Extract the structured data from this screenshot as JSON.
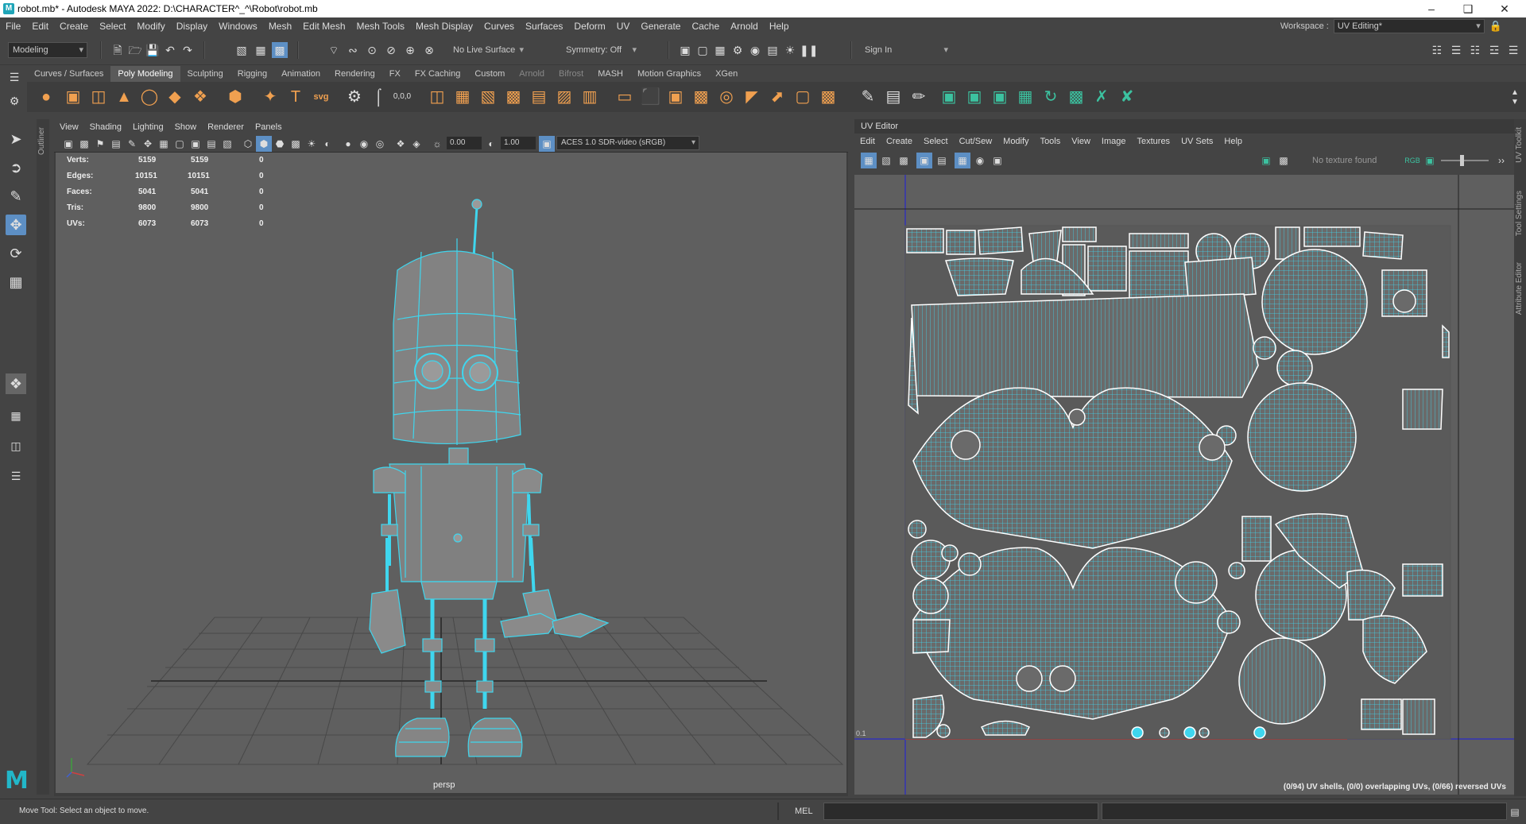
{
  "window": {
    "title": "robot.mb* - Autodesk MAYA 2022: D:\\CHARACTER^_^\\Robot\\robot.mb"
  },
  "menus": [
    "File",
    "Edit",
    "Create",
    "Select",
    "Modify",
    "Display",
    "Windows",
    "Mesh",
    "Edit Mesh",
    "Mesh Tools",
    "Mesh Display",
    "Curves",
    "Surfaces",
    "Deform",
    "UV",
    "Generate",
    "Cache",
    "Arnold",
    "Help"
  ],
  "workspace": {
    "label": "Workspace :",
    "value": "UV Editing*"
  },
  "status_line": {
    "menu_set": "Modeling",
    "live_surface": "No Live Surface",
    "symmetry": "Symmetry: Off",
    "sign_in": "Sign In"
  },
  "shelf_tabs": [
    "Curves / Surfaces",
    "Poly Modeling",
    "Sculpting",
    "Rigging",
    "Animation",
    "Rendering",
    "FX",
    "FX Caching",
    "Custom",
    "Arnold",
    "Bifrost",
    "MASH",
    "Motion Graphics",
    "XGen"
  ],
  "shelf_active": "Poly Modeling",
  "outliner_label": "Outliner",
  "viewport": {
    "menus": [
      "View",
      "Shading",
      "Lighting",
      "Show",
      "Renderer",
      "Panels"
    ],
    "exposure": "0.00",
    "gamma": "1.00",
    "color_space": "ACES 1.0 SDR-video (sRGB)",
    "hud": [
      {
        "label": "Verts:",
        "a": "5159",
        "b": "5159",
        "c": "0"
      },
      {
        "label": "Edges:",
        "a": "10151",
        "b": "10151",
        "c": "0"
      },
      {
        "label": "Faces:",
        "a": "5041",
        "b": "5041",
        "c": "0"
      },
      {
        "label": "Tris:",
        "a": "9800",
        "b": "9800",
        "c": "0"
      },
      {
        "label": "UVs:",
        "a": "6073",
        "b": "6073",
        "c": "0"
      }
    ],
    "camera": "persp"
  },
  "uv_editor": {
    "title": "UV Editor",
    "menus": [
      "Edit",
      "Create",
      "Select",
      "Cut/Sew",
      "Modify",
      "Tools",
      "View",
      "Image",
      "Textures",
      "UV Sets",
      "Help"
    ],
    "texture": "No texture found",
    "info": "(0/94) UV shells, (0/0) overlapping UVs, (0/66) reversed UVs",
    "grid_label": "0.1"
  },
  "right_tabs": [
    "UV Toolkit",
    "Tool Settings",
    "Attribute Editor"
  ],
  "bottom": {
    "help": "Move Tool: Select an object to move.",
    "mel": "MEL"
  },
  "colors": {
    "wire": "#3fd6ee",
    "accent": "#5d8fc4",
    "shelf_icon": "#f0a050"
  }
}
